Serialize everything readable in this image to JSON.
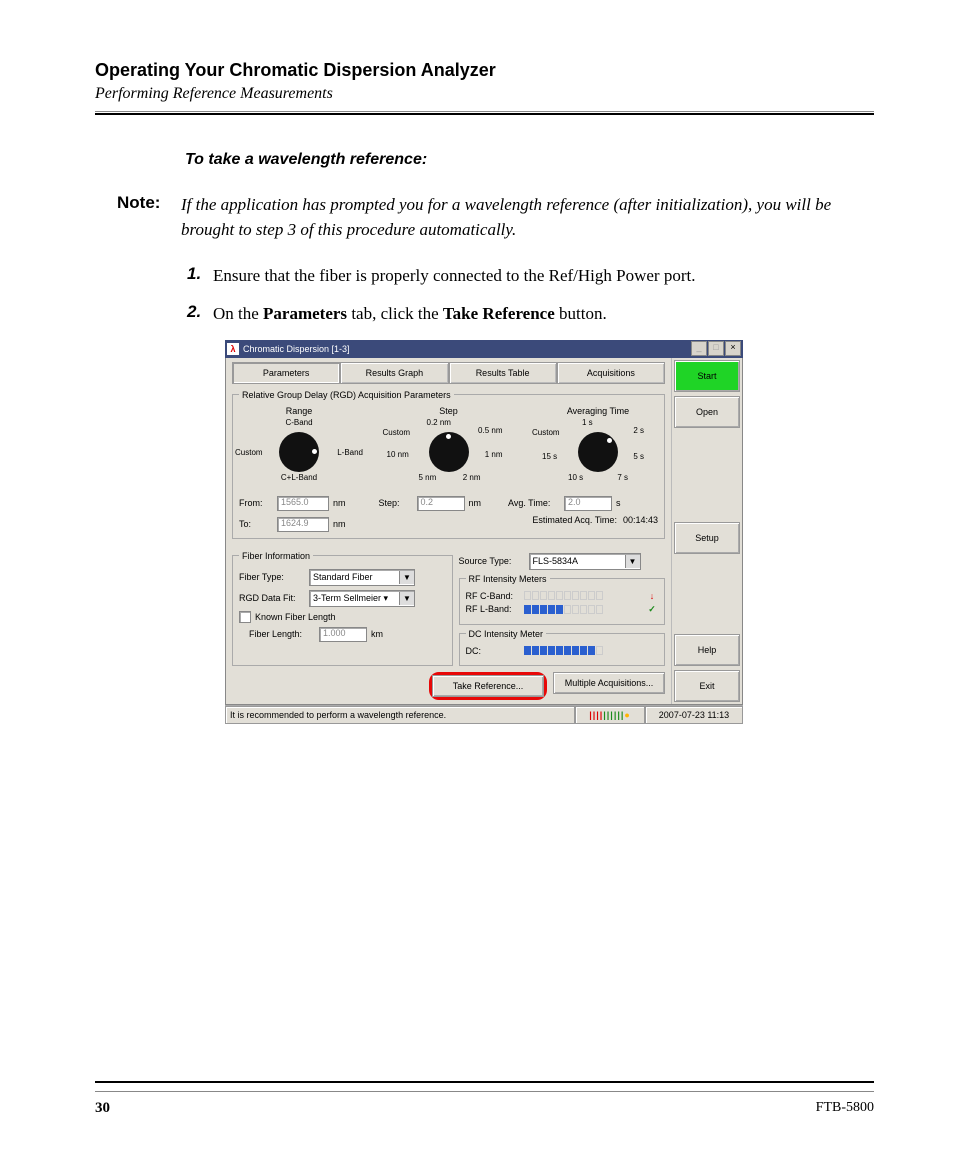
{
  "doc": {
    "chapter_title": "Operating Your Chromatic Dispersion Analyzer",
    "section_title": "Performing Reference Measurements",
    "proc_heading": "To take a wavelength reference:",
    "note_label": "Note:",
    "note_text": "If the application has prompted you for a wavelength reference (after initialization), you will be brought to step 3 of this procedure automatically.",
    "steps": {
      "s1num": "1.",
      "s1text": "Ensure that the fiber is properly connected to the Ref/High Power port.",
      "s2num": "2.",
      "s2_pre": "On the ",
      "s2_b1": "Parameters",
      "s2_mid": " tab, click the ",
      "s2_b2": "Take Reference",
      "s2_post": " button."
    },
    "page_number": "30",
    "model": "FTB-5800"
  },
  "app": {
    "title": "Chromatic Dispersion [1-3]",
    "tabs": {
      "parameters": "Parameters",
      "results_graph": "Results Graph",
      "results_table": "Results Table",
      "acquisitions": "Acquisitions"
    },
    "sidebar": {
      "start": "Start",
      "open": "Open",
      "setup": "Setup",
      "help": "Help",
      "exit": "Exit"
    },
    "fs_rgd": "Relative Group Delay (RGD) Acquisition Parameters",
    "dials": {
      "range": {
        "title": "Range",
        "top": "C-Band",
        "left": "Custom",
        "right": "L-Band",
        "bottom": "C+L-Band"
      },
      "step": {
        "title": "Step",
        "t1": "0.2 nm",
        "t2": "0.5 nm",
        "l1": "Custom",
        "l2": "10 nm",
        "r2": "1 nm",
        "b1": "5 nm",
        "b2": "2 nm"
      },
      "avg": {
        "title": "Averaging Time",
        "t1": "1 s",
        "t2": "2 s",
        "l1": "Custom",
        "l2": "15 s",
        "r2": "5 s",
        "b1": "10 s",
        "b2": "7 s"
      }
    },
    "fields": {
      "from_lbl": "From:",
      "from_val": "1565.0",
      "from_unit": "nm",
      "to_lbl": "To:",
      "to_val": "1624.9",
      "to_unit": "nm",
      "step_lbl": "Step:",
      "step_val": "0.2",
      "step_unit": "nm",
      "avg_lbl": "Avg. Time:",
      "avg_val": "2.0",
      "avg_unit": "s",
      "est_lbl": "Estimated Acq. Time:",
      "est_val": "00:14:43"
    },
    "fiber": {
      "legend": "Fiber Information",
      "type_lbl": "Fiber Type:",
      "type_val": "Standard Fiber",
      "fit_lbl": "RGD Data Fit:",
      "fit_val": "3-Term Sellmeier ▾",
      "known_lbl": "Known Fiber Length",
      "len_lbl": "Fiber Length:",
      "len_val": "1.000",
      "len_unit": "km"
    },
    "source": {
      "type_lbl": "Source Type:",
      "type_val": "FLS-5834A",
      "rf_legend": "RF Intensity Meters",
      "rf_c_lbl": "RF C-Band:",
      "rf_l_lbl": "RF L-Band:",
      "dc_legend": "DC Intensity Meter",
      "dc_lbl": "DC:"
    },
    "actions": {
      "take_ref": "Take Reference...",
      "multi": "Multiple Acquisitions..."
    },
    "status": {
      "msg": "It is recommended to perform a wavelength reference.",
      "time": "2007-07-23 11:13"
    },
    "winbtns": {
      "min": "_",
      "max": "□",
      "close": "×"
    }
  }
}
